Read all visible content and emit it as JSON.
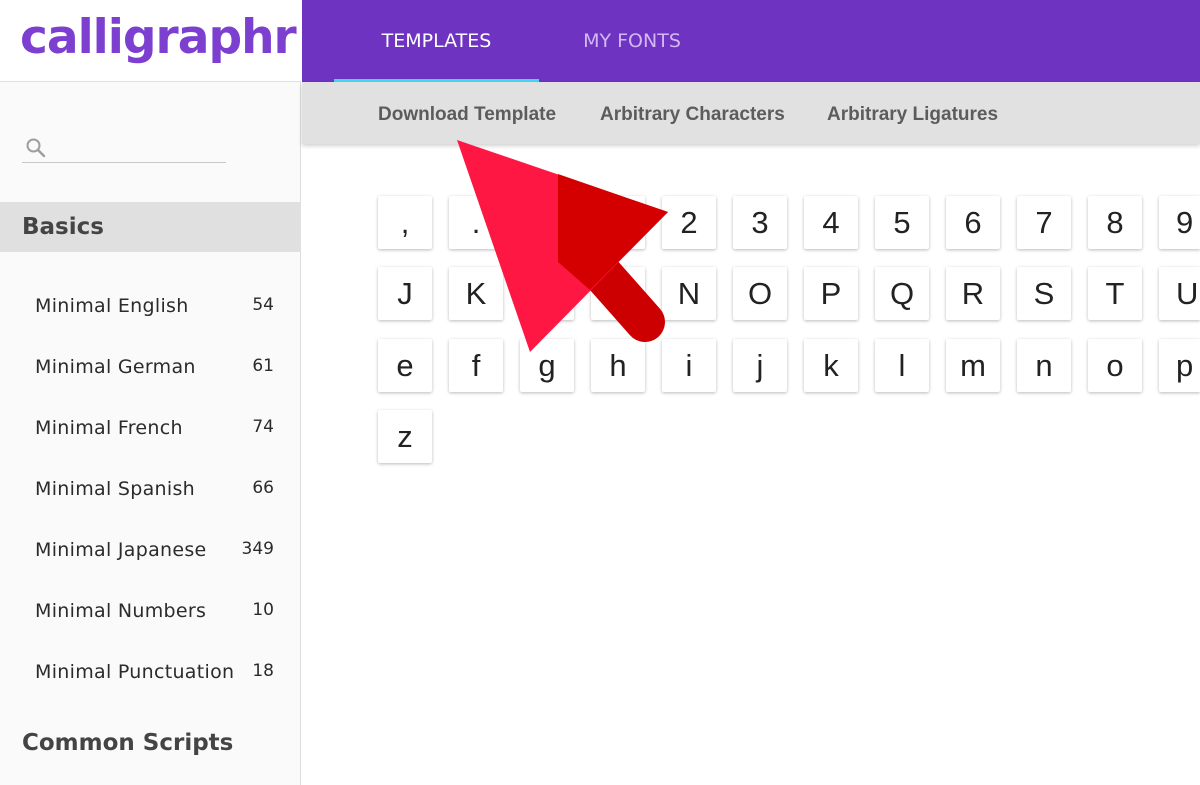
{
  "brand": {
    "logo_text": "calligraphr",
    "accent": "#6f33c2",
    "tab_indicator": "#40d9f0",
    "arrow_color": "#ff1744"
  },
  "search": {
    "placeholder": "",
    "icon": "search-icon"
  },
  "sidebar": {
    "section_basics": "Basics",
    "items": [
      {
        "label": "Minimal English",
        "count": "54"
      },
      {
        "label": "Minimal German",
        "count": "61"
      },
      {
        "label": "Minimal French",
        "count": "74"
      },
      {
        "label": "Minimal Spanish",
        "count": "66"
      },
      {
        "label": "Minimal Japanese",
        "count": "349"
      },
      {
        "label": "Minimal Numbers",
        "count": "10"
      },
      {
        "label": "Minimal Punctuation",
        "count": "18"
      }
    ],
    "section_common": "Common Scripts"
  },
  "topbar": {
    "tabs": [
      {
        "label": "TEMPLATES",
        "active": true
      },
      {
        "label": "MY FONTS",
        "active": false
      }
    ]
  },
  "subbar": {
    "links": [
      "Download Template",
      "Arbitrary Characters",
      "Arbitrary Ligatures"
    ]
  },
  "chars": {
    "row1": [
      ",",
      ".",
      "",
      "",
      "2",
      "3",
      "4",
      "5",
      "6",
      "7",
      "8",
      "9"
    ],
    "row2": [
      "J",
      "K",
      "",
      "",
      "N",
      "O",
      "P",
      "Q",
      "R",
      "S",
      "T",
      "U"
    ],
    "row3": [
      "e",
      "f",
      "g",
      "h",
      "i",
      "j",
      "k",
      "l",
      "m",
      "n",
      "o",
      "p"
    ],
    "row4": [
      "z"
    ]
  }
}
